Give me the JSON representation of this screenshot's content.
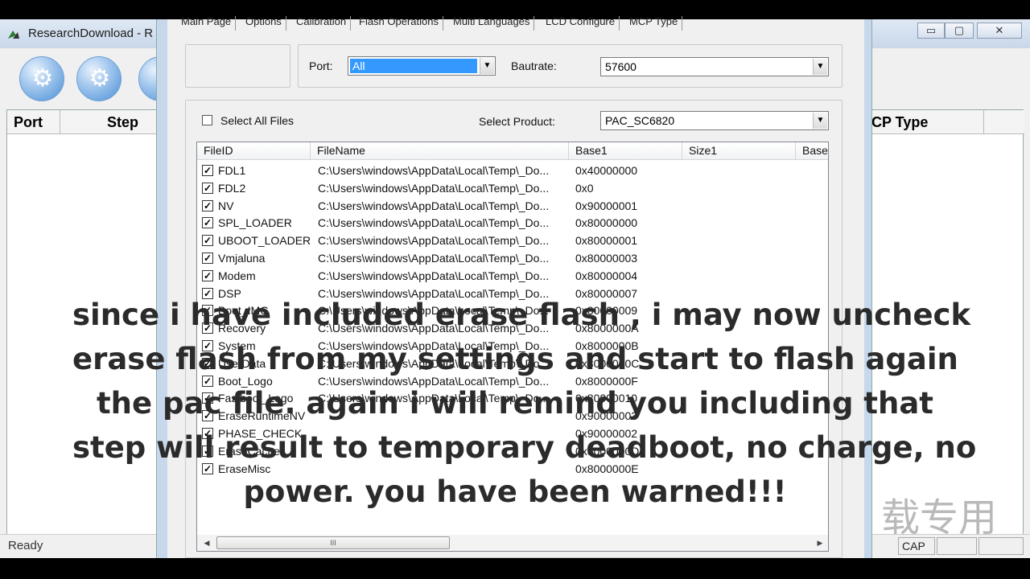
{
  "background_window": {
    "title": "ResearchDownload - R",
    "controls": {
      "minimize": "▭",
      "maximize": "▢",
      "close": "✕"
    },
    "toolbar_buttons": [
      {
        "icon": "gear-icon"
      },
      {
        "icon": "gears-icon"
      },
      {
        "icon": "arrow-icon"
      }
    ],
    "table_headers": {
      "port": "Port",
      "step": "Step",
      "mcp_type": "CP Type"
    },
    "status": {
      "ready": "Ready",
      "cap": "CAP"
    },
    "watermark": "载专用"
  },
  "dialog": {
    "tabs": [
      "Main Page",
      "Options",
      "Calibration",
      "Flash Operations",
      "Multi Languages",
      "LCD Configure",
      "MCP Type"
    ],
    "port_label": "Port:",
    "port_value": "All",
    "baudrate_label": "Bautrate:",
    "baudrate_value": "57600",
    "select_all_label": "Select All Files",
    "select_product_label": "Select Product:",
    "product_value": "PAC_SC6820",
    "columns": [
      "FileID",
      "FileName",
      "Base1",
      "Size1",
      "Base2"
    ],
    "files": [
      {
        "id": "FDL1",
        "name": "C:\\Users\\windows\\AppData\\Local\\Temp\\_Do...",
        "base": "0x40000000",
        "checked": true
      },
      {
        "id": "FDL2",
        "name": "C:\\Users\\windows\\AppData\\Local\\Temp\\_Do...",
        "base": "0x0",
        "checked": true
      },
      {
        "id": "NV",
        "name": "C:\\Users\\windows\\AppData\\Local\\Temp\\_Do...",
        "base": "0x90000001",
        "checked": true
      },
      {
        "id": "SPL_LOADER",
        "name": "C:\\Users\\windows\\AppData\\Local\\Temp\\_Do...",
        "base": "0x80000000",
        "checked": true
      },
      {
        "id": "UBOOT_LOADER",
        "name": "C:\\Users\\windows\\AppData\\Local\\Temp\\_Do...",
        "base": "0x80000001",
        "checked": true
      },
      {
        "id": "Vmjaluna",
        "name": "C:\\Users\\windows\\AppData\\Local\\Temp\\_Do...",
        "base": "0x80000003",
        "checked": true
      },
      {
        "id": "Modem",
        "name": "C:\\Users\\windows\\AppData\\Local\\Temp\\_Do...",
        "base": "0x80000004",
        "checked": true
      },
      {
        "id": "DSP",
        "name": "C:\\Users\\windows\\AppData\\Local\\Temp\\_Do...",
        "base": "0x80000007",
        "checked": true
      },
      {
        "id": "Boot_IMG",
        "name": "C:\\Users\\windows\\AppData\\Local\\Temp\\_Do...",
        "base": "0x80000009",
        "checked": true
      },
      {
        "id": "Recovery",
        "name": "C:\\Users\\windows\\AppData\\Local\\Temp\\_Do...",
        "base": "0x8000000A",
        "checked": true
      },
      {
        "id": "System",
        "name": "C:\\Users\\windows\\AppData\\Local\\Temp\\_Do...",
        "base": "0x8000000B",
        "checked": true
      },
      {
        "id": "UserData",
        "name": "C:\\Users\\windows\\AppData\\Local\\Temp\\_Do...",
        "base": "0x8000000C",
        "checked": true
      },
      {
        "id": "Boot_Logo",
        "name": "C:\\Users\\windows\\AppData\\Local\\Temp\\_Do...",
        "base": "0x8000000F",
        "checked": true
      },
      {
        "id": "Fastboot_Logo",
        "name": "C:\\Users\\windows\\AppData\\Local\\Temp\\_Do...",
        "base": "0x80000010",
        "checked": true
      },
      {
        "id": "EraseRuntimeNV",
        "name": "",
        "base": "0x90000003",
        "checked": true
      },
      {
        "id": "PHASE_CHECK",
        "name": "",
        "base": "0x90000002",
        "checked": true
      },
      {
        "id": "EraseCache",
        "name": "",
        "base": "0x8000000D",
        "checked": true
      },
      {
        "id": "EraseMisc",
        "name": "",
        "base": "0x8000000E",
        "checked": true
      }
    ],
    "scroll_grip": "III"
  },
  "caption": {
    "lines": [
      "since i have included erase flash , i may now uncheck",
      "erase flash from my settings and start to flash again",
      "the pac file.  again i will remind you including that",
      "step will result to temporary deadboot, no charge, no",
      "power. you have been warned!!!"
    ]
  }
}
